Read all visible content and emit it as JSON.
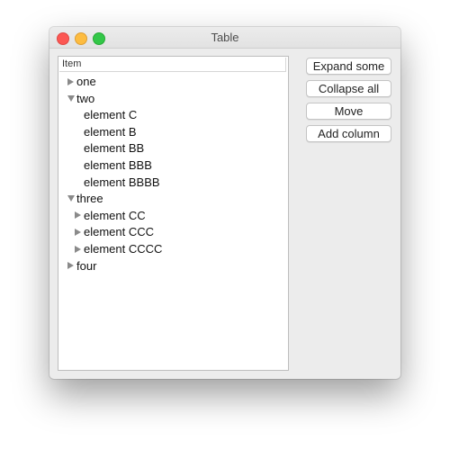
{
  "window": {
    "title": "Table"
  },
  "table": {
    "column_header": "Item",
    "rows": [
      {
        "label": "one",
        "level": 0,
        "expander": "collapsed"
      },
      {
        "label": "two",
        "level": 0,
        "expander": "expanded"
      },
      {
        "label": "element C",
        "level": 1,
        "expander": "none"
      },
      {
        "label": "element B",
        "level": 1,
        "expander": "none"
      },
      {
        "label": "element BB",
        "level": 1,
        "expander": "none"
      },
      {
        "label": "element BBB",
        "level": 1,
        "expander": "none"
      },
      {
        "label": "element BBBB",
        "level": 1,
        "expander": "none"
      },
      {
        "label": "three",
        "level": 0,
        "expander": "expanded"
      },
      {
        "label": "element CC",
        "level": 1,
        "expander": "collapsed"
      },
      {
        "label": "element CCC",
        "level": 1,
        "expander": "collapsed"
      },
      {
        "label": "element CCCC",
        "level": 1,
        "expander": "collapsed"
      },
      {
        "label": "four",
        "level": 0,
        "expander": "collapsed"
      }
    ]
  },
  "buttons": {
    "expand_some": "Expand some",
    "collapse_all": "Collapse all",
    "move": "Move",
    "add_column": "Add column"
  }
}
